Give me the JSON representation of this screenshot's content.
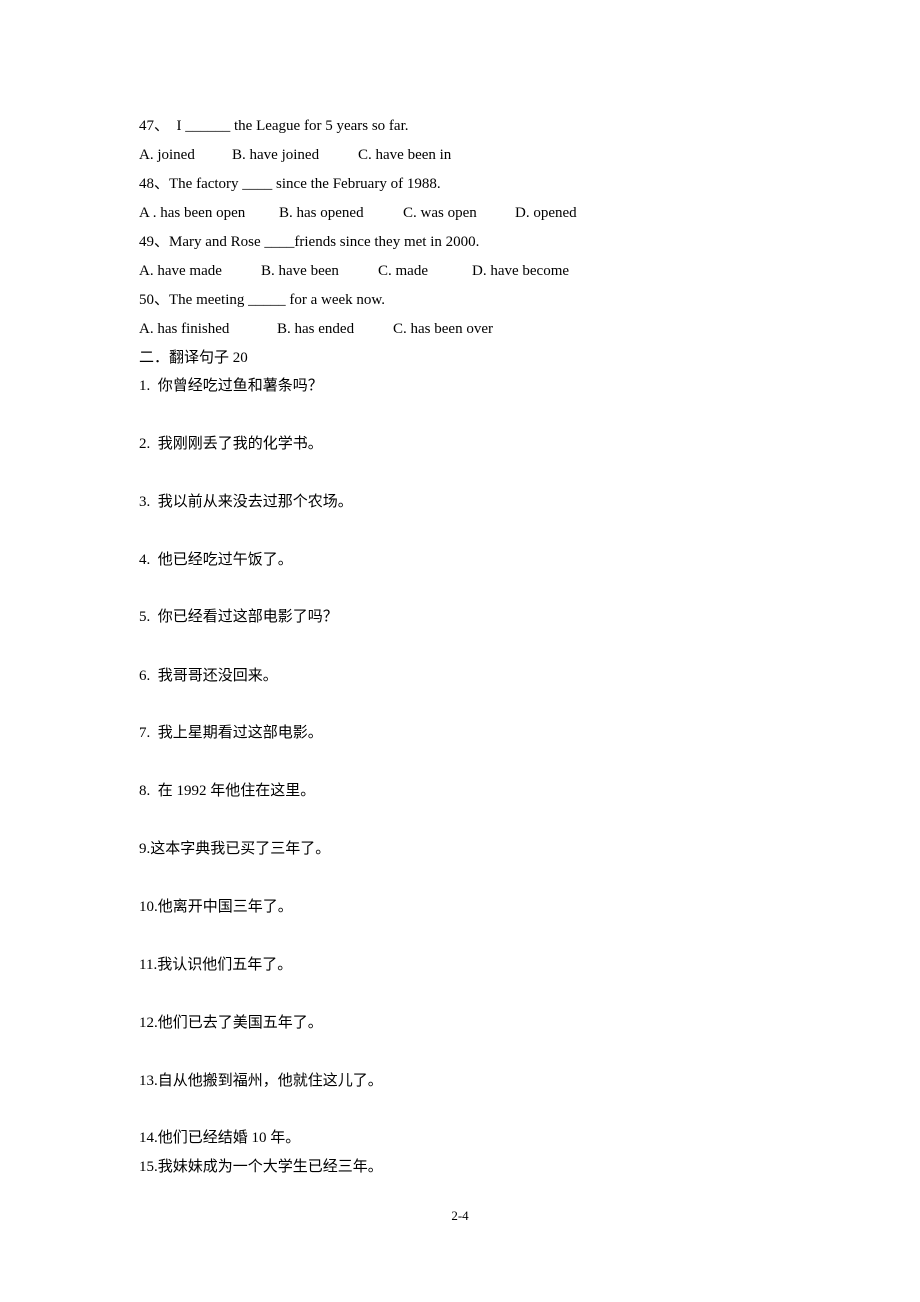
{
  "questions": [
    {
      "stem": "47、  I ______ the League for 5 years so far.",
      "options": [
        "A. joined",
        "B. have joined",
        "C. have been in"
      ]
    },
    {
      "stem": "48、The factory ____ since the February of 1988.",
      "options": [
        "A . has been open",
        "B. has opened",
        "C. was open",
        "D. opened"
      ]
    },
    {
      "stem": "49、Mary and Rose ____friends since they met in 2000.",
      "options": [
        "A. have made",
        "B. have been",
        "C. made",
        "D. have become"
      ]
    },
    {
      "stem": "50、The meeting _____ for a week now.",
      "options": [
        "A. has finished",
        "B. has ended",
        "C. has been over"
      ]
    }
  ],
  "section2": {
    "heading": "二．翻译句子 20",
    "items": [
      "1.  你曾经吃过鱼和薯条吗？",
      "2.  我刚刚丢了我的化学书。",
      "3.  我以前从来没去过那个农场。",
      "4.  他已经吃过午饭了。",
      "5.  你已经看过这部电影了吗？",
      "6.  我哥哥还没回来。",
      "7.  我上星期看过这部电影。",
      "8.  在 1992 年他住在这里。",
      "9.这本字典我已买了三年了。",
      "10.他离开中国三年了。",
      "11.我认识他们五年了。",
      "12.他们已去了美国五年了。",
      "13.自从他搬到福州，他就住这儿了。",
      "14.他们已经结婚 10 年。",
      "15.我妹妹成为一个大学生已经三年。"
    ]
  },
  "footer": {
    "page_number": "2-4"
  }
}
